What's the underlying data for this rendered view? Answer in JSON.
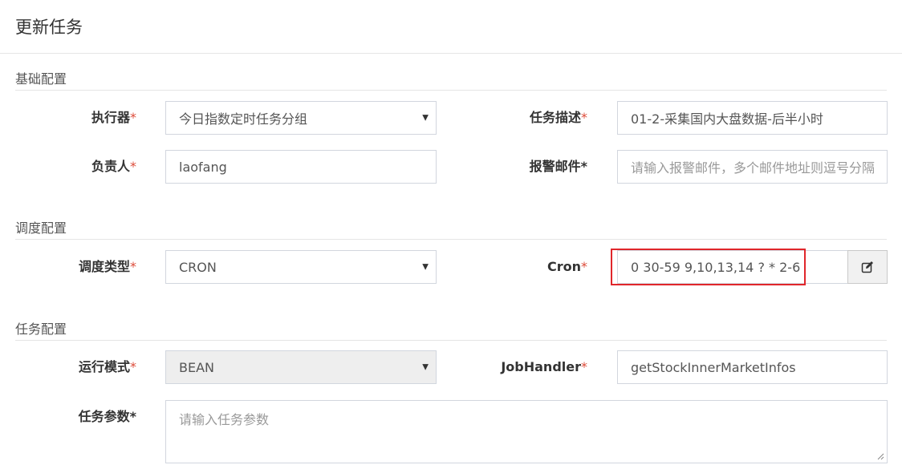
{
  "modal": {
    "title": "更新任务"
  },
  "sections": {
    "basic": "基础配置",
    "schedule": "调度配置",
    "task": "任务配置"
  },
  "fields": {
    "executor": {
      "label": "执行器",
      "value": "今日指数定时任务分组"
    },
    "job_desc": {
      "label": "任务描述",
      "value": "01-2-采集国内大盘数据-后半小时"
    },
    "author": {
      "label": "负责人",
      "value": "laofang"
    },
    "alarm_email": {
      "label": "报警邮件",
      "placeholder": "请输入报警邮件，多个邮件地址则逗号分隔"
    },
    "schedule_type": {
      "label": "调度类型",
      "value": "CRON"
    },
    "cron": {
      "label": "Cron",
      "value": "0 30-59 9,10,13,14 ? * 2-6"
    },
    "run_mode": {
      "label": "运行模式",
      "value": "BEAN"
    },
    "job_handler": {
      "label": "JobHandler",
      "value": "getStockInnerMarketInfos"
    },
    "job_param": {
      "label": "任务参数",
      "placeholder": "请输入任务参数"
    }
  },
  "required_mark": "*",
  "icons": {
    "cron_edit": "edit-icon",
    "select_arrow": "caret-down-icon"
  },
  "colors": {
    "required": "#dd4b39",
    "highlight": "#e0262b"
  }
}
